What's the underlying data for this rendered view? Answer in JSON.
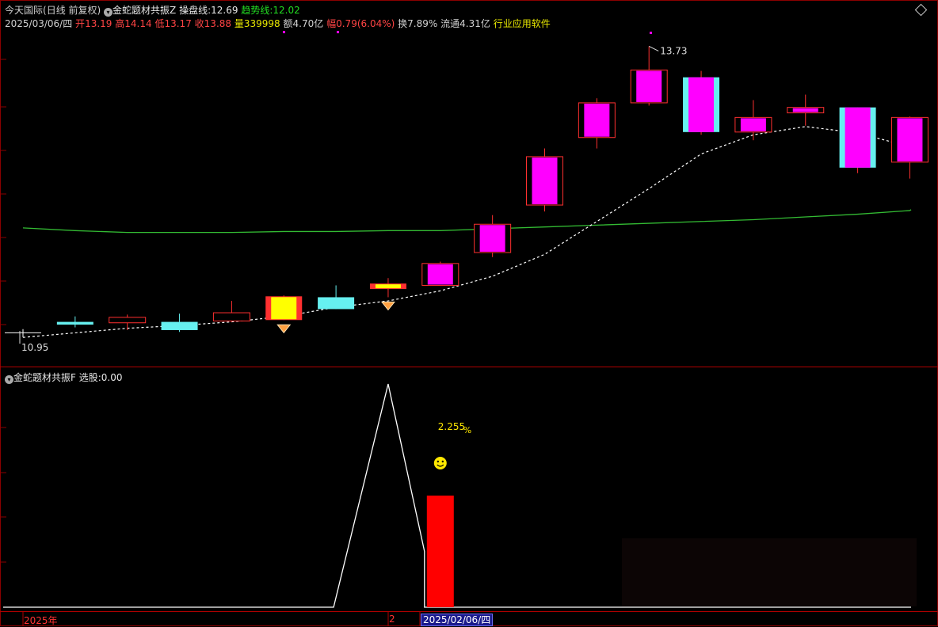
{
  "header": {
    "stock_name": "今天国际",
    "period": "(日线 前复权)",
    "indicator_name": "金蛇题材共振Z",
    "line1_label": "操盘线:",
    "line1_value": "12.69",
    "line2_label": "趋势线:",
    "line2_value": "12.02"
  },
  "quote": {
    "date": "2025/03/06/四",
    "open_label": "开",
    "open": "13.19",
    "high_label": "高",
    "high": "14.14",
    "low_label": "低",
    "low": "13.17",
    "close_label": "收",
    "close": "13.88",
    "volume_label": "量",
    "volume": "339998",
    "amount_label": "额",
    "amount": "4.70亿",
    "change_label": "幅",
    "change": "0.79(6.04%)",
    "turnover_label": "换",
    "turnover": "7.89%",
    "float_label": "流通",
    "float": "4.31亿",
    "industry": "行业应用软件"
  },
  "sub": {
    "indicator_name": "金蛇题材共振F",
    "select_label": "选股:",
    "select_value": "0.00"
  },
  "colors": {
    "up_border": "#ff3030",
    "up_fill_magenta": "#ff00ff",
    "down_fill_cyan": "#66f0f0",
    "yellow": "#ffff00",
    "trend_line": "#33bb33",
    "dash_line": "#ffffff",
    "signal_bar": "#ff0000",
    "grid": "#8b0000"
  },
  "axis": {
    "year": "2025年",
    "num": "2",
    "date": "2025/02/06/四"
  },
  "chart_data": [
    {
      "type": "candlestick",
      "ylim": [
        10.7,
        14.3
      ],
      "max_label": "13.73",
      "min_label": "10.95",
      "candles": [
        {
          "o": 11.0,
          "h": 11.04,
          "l": 10.95,
          "c": 11.0,
          "kind": "tick"
        },
        {
          "o": 11.12,
          "h": 11.18,
          "l": 11.06,
          "c": 11.09,
          "kind": "cyan"
        },
        {
          "o": 11.11,
          "h": 11.2,
          "l": 11.03,
          "c": 11.17,
          "kind": "hollow"
        },
        {
          "o": 11.12,
          "h": 11.21,
          "l": 11.01,
          "c": 11.03,
          "kind": "cyan"
        },
        {
          "o": 11.13,
          "h": 11.35,
          "l": 11.12,
          "c": 11.22,
          "kind": "hollow"
        },
        {
          "o": 11.14,
          "h": 11.41,
          "l": 11.14,
          "c": 11.4,
          "kind": "yellow"
        },
        {
          "o": 11.39,
          "h": 11.52,
          "l": 11.26,
          "c": 11.26,
          "kind": "cyan"
        },
        {
          "o": 11.48,
          "h": 11.6,
          "l": 11.39,
          "c": 11.54,
          "kind": "yellow"
        },
        {
          "o": 11.52,
          "h": 11.78,
          "l": 11.52,
          "c": 11.76,
          "kind": "magenta"
        },
        {
          "o": 11.88,
          "h": 12.29,
          "l": 11.83,
          "c": 12.19,
          "kind": "magenta"
        },
        {
          "o": 12.4,
          "h": 13.02,
          "l": 12.33,
          "c": 12.93,
          "kind": "magenta"
        },
        {
          "o": 13.14,
          "h": 13.57,
          "l": 13.02,
          "c": 13.52,
          "kind": "magenta"
        },
        {
          "o": 13.52,
          "h": 14.14,
          "l": 13.49,
          "c": 13.88,
          "kind": "magenta"
        },
        {
          "o": 13.8,
          "h": 13.87,
          "l": 13.17,
          "c": 13.2,
          "kind": "cyan_magenta"
        },
        {
          "o": 13.2,
          "h": 13.55,
          "l": 13.11,
          "c": 13.36,
          "kind": "magenta"
        },
        {
          "o": 13.41,
          "h": 13.61,
          "l": 13.27,
          "c": 13.47,
          "kind": "magenta"
        },
        {
          "o": 13.47,
          "h": 13.47,
          "l": 12.75,
          "c": 12.81,
          "kind": "cyan_magenta"
        },
        {
          "o": 12.87,
          "h": 13.37,
          "l": 12.69,
          "c": 13.36,
          "kind": "magenta"
        }
      ],
      "operating_line": [
        10.95,
        11.0,
        11.05,
        11.08,
        11.12,
        11.18,
        11.28,
        11.35,
        11.46,
        11.62,
        11.86,
        12.22,
        12.58,
        12.96,
        13.17,
        13.26,
        13.19,
        13.04
      ],
      "trend_line": [
        12.15,
        12.12,
        12.1,
        12.1,
        12.1,
        12.11,
        12.11,
        12.12,
        12.12,
        12.14,
        12.16,
        12.18,
        12.2,
        12.22,
        12.24,
        12.27,
        12.3,
        12.34
      ],
      "markers": [
        {
          "type": "diamond",
          "index": 5
        },
        {
          "type": "diamond",
          "index": 7
        }
      ]
    },
    {
      "type": "line",
      "title": "金蛇题材共振F",
      "ylim": [
        0,
        100
      ],
      "line_points": [
        0,
        0,
        0,
        0,
        0,
        0,
        0,
        100,
        25,
        0,
        0,
        0,
        0,
        0,
        0,
        0,
        0,
        0
      ],
      "signal_bar": {
        "index": 8,
        "value": 50
      },
      "annotation": "2.255",
      "annotation_unit": "%"
    }
  ]
}
